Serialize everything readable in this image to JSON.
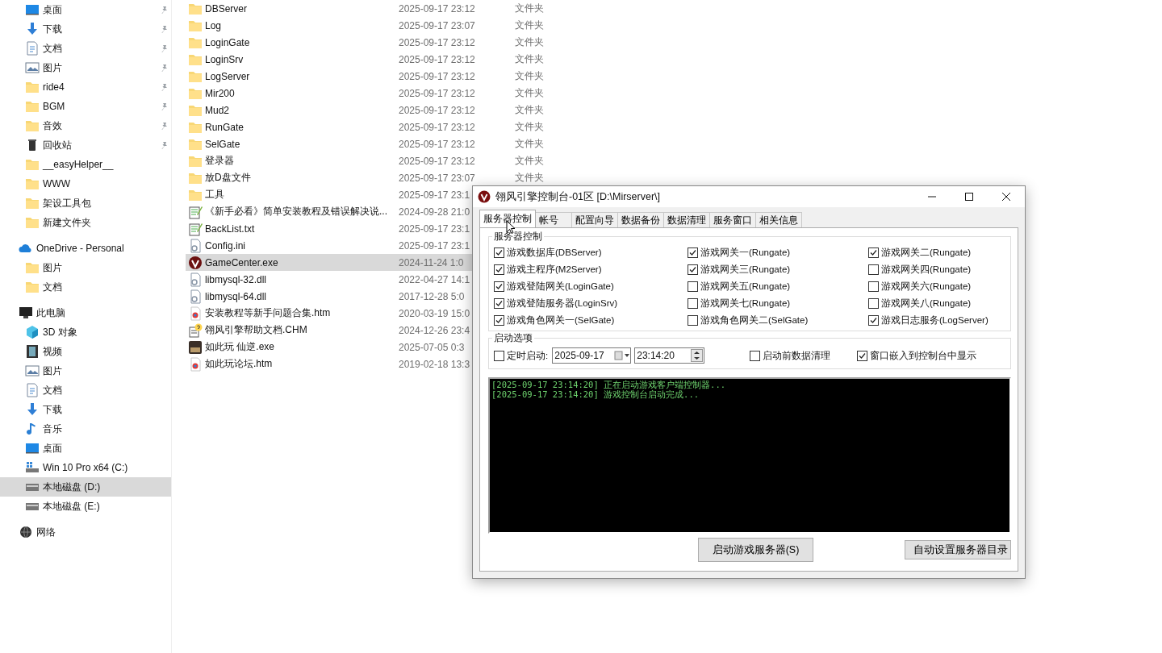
{
  "sidebar": {
    "groups": [
      {
        "items": [
          {
            "label": "桌面",
            "kind": "desktop",
            "pinned": true,
            "selected": false
          },
          {
            "label": "下载",
            "kind": "download",
            "pinned": true,
            "selected": false
          },
          {
            "label": "文档",
            "kind": "document",
            "pinned": true,
            "selected": false
          },
          {
            "label": "图片",
            "kind": "pictures",
            "pinned": true,
            "selected": false
          },
          {
            "label": "ride4",
            "kind": "folder",
            "pinned": true,
            "selected": false
          },
          {
            "label": "BGM",
            "kind": "folder",
            "pinned": true,
            "selected": false
          },
          {
            "label": "音效",
            "kind": "folder",
            "pinned": true,
            "selected": false
          },
          {
            "label": "回收站",
            "kind": "recycle",
            "pinned": true,
            "selected": false
          },
          {
            "label": "__easyHelper__",
            "kind": "folder",
            "pinned": false,
            "selected": false
          },
          {
            "label": "WWW",
            "kind": "folder",
            "pinned": false,
            "selected": false
          },
          {
            "label": "架设工具包",
            "kind": "folder",
            "pinned": false,
            "selected": false
          },
          {
            "label": "新建文件夹",
            "kind": "folder",
            "pinned": false,
            "selected": false
          }
        ]
      },
      {
        "header": {
          "label": "OneDrive - Personal",
          "kind": "cloud",
          "selected": false
        },
        "items": [
          {
            "label": "图片",
            "kind": "folder",
            "pinned": false,
            "selected": false
          },
          {
            "label": "文档",
            "kind": "folder",
            "pinned": false,
            "selected": false
          }
        ]
      },
      {
        "header": {
          "label": "此电脑",
          "kind": "pc",
          "selected": false
        },
        "items": [
          {
            "label": "3D 对象",
            "kind": "cube",
            "pinned": false,
            "selected": false
          },
          {
            "label": "视频",
            "kind": "video",
            "pinned": false,
            "selected": false
          },
          {
            "label": "图片",
            "kind": "pictures",
            "pinned": false,
            "selected": false
          },
          {
            "label": "文档",
            "kind": "document",
            "pinned": false,
            "selected": false
          },
          {
            "label": "下载",
            "kind": "download",
            "pinned": false,
            "selected": false
          },
          {
            "label": "音乐",
            "kind": "music",
            "pinned": false,
            "selected": false
          },
          {
            "label": "桌面",
            "kind": "desktop",
            "pinned": false,
            "selected": false
          },
          {
            "label": "Win 10 Pro x64 (C:)",
            "kind": "sysdrive",
            "pinned": false,
            "selected": false
          },
          {
            "label": "本地磁盘 (D:)",
            "kind": "drive",
            "pinned": false,
            "selected": true
          },
          {
            "label": "本地磁盘 (E:)",
            "kind": "drive",
            "pinned": false,
            "selected": false
          }
        ]
      },
      {
        "header": {
          "label": "网络",
          "kind": "network",
          "selected": false
        }
      }
    ]
  },
  "files": [
    {
      "name": "DBServer",
      "kind": "folder",
      "date": "2025-09-17 23:12",
      "type": "文件夹",
      "selected": false
    },
    {
      "name": "Log",
      "kind": "folder",
      "date": "2025-09-17 23:07",
      "type": "文件夹",
      "selected": false
    },
    {
      "name": "LoginGate",
      "kind": "folder",
      "date": "2025-09-17 23:12",
      "type": "文件夹",
      "selected": false
    },
    {
      "name": "LoginSrv",
      "kind": "folder",
      "date": "2025-09-17 23:12",
      "type": "文件夹",
      "selected": false
    },
    {
      "name": "LogServer",
      "kind": "folder",
      "date": "2025-09-17 23:12",
      "type": "文件夹",
      "selected": false
    },
    {
      "name": "Mir200",
      "kind": "folder",
      "date": "2025-09-17 23:12",
      "type": "文件夹",
      "selected": false
    },
    {
      "name": "Mud2",
      "kind": "folder",
      "date": "2025-09-17 23:12",
      "type": "文件夹",
      "selected": false
    },
    {
      "name": "RunGate",
      "kind": "folder",
      "date": "2025-09-17 23:12",
      "type": "文件夹",
      "selected": false
    },
    {
      "name": "SelGate",
      "kind": "folder",
      "date": "2025-09-17 23:12",
      "type": "文件夹",
      "selected": false
    },
    {
      "name": "登录器",
      "kind": "folder",
      "date": "2025-09-17 23:12",
      "type": "文件夹",
      "selected": false
    },
    {
      "name": "放D盘文件",
      "kind": "folder",
      "date": "2025-09-17 23:07",
      "type": "文件夹",
      "selected": false
    },
    {
      "name": "工具",
      "kind": "folder",
      "date": "2025-09-17 23:1",
      "selected": false
    },
    {
      "name": "《新手必看》简单安装教程及错误解决说...",
      "kind": "text",
      "date": "2024-09-28 21:0",
      "selected": false
    },
    {
      "name": "BackList.txt",
      "kind": "text",
      "date": "2025-09-17 23:1",
      "selected": false
    },
    {
      "name": "Config.ini",
      "kind": "config",
      "date": "2025-09-17 23:1",
      "selected": false
    },
    {
      "name": "GameCenter.exe",
      "kind": "app",
      "date": "2024-11-24 1:0",
      "selected": true
    },
    {
      "name": "libmysql-32.dll",
      "kind": "config",
      "date": "2022-04-27 14:1",
      "selected": false
    },
    {
      "name": "libmysql-64.dll",
      "kind": "config",
      "date": "2017-12-28 5:0",
      "selected": false
    },
    {
      "name": "安装教程等新手问题合集.htm",
      "kind": "web",
      "date": "2020-03-19 15:0",
      "selected": false
    },
    {
      "name": "翎风引擎帮助文档.CHM",
      "kind": "help",
      "date": "2024-12-26 23:4",
      "selected": false
    },
    {
      "name": "如此玩 仙逆.exe",
      "kind": "game",
      "date": "2025-07-05 0:3",
      "selected": false
    },
    {
      "name": "如此玩论坛.htm",
      "kind": "web",
      "date": "2019-02-18 13:3",
      "selected": false
    }
  ],
  "window": {
    "title": "翎风引擎控制台-01区 [D:\\Mirserver\\]",
    "tabs": [
      {
        "label": "服务器控制",
        "selected": true
      },
      {
        "label": "帐号",
        "selected": false
      },
      {
        "label": "配置向导",
        "selected": false
      },
      {
        "label": "数据备份",
        "selected": false
      },
      {
        "label": "数据清理",
        "selected": false
      },
      {
        "label": "服务窗口",
        "selected": false
      },
      {
        "label": "相关信息",
        "selected": false
      }
    ],
    "server_group": {
      "title": "服务器控制",
      "checkboxes": [
        {
          "label": "游戏数据库(DBServer)",
          "checked": true
        },
        {
          "label": "游戏网关一(Rungate)",
          "checked": true
        },
        {
          "label": "游戏网关二(Rungate)",
          "checked": true
        },
        {
          "label": "游戏主程序(M2Server)",
          "checked": true
        },
        {
          "label": "游戏网关三(Rungate)",
          "checked": true
        },
        {
          "label": "游戏网关四(Rungate)",
          "checked": false
        },
        {
          "label": "游戏登陆网关(LoginGate)",
          "checked": true
        },
        {
          "label": "游戏网关五(Rungate)",
          "checked": false
        },
        {
          "label": "游戏网关六(Rungate)",
          "checked": false
        },
        {
          "label": "游戏登陆服务器(LoginSrv)",
          "checked": true
        },
        {
          "label": "游戏网关七(Rungate)",
          "checked": false
        },
        {
          "label": "游戏网关八(Rungate)",
          "checked": false
        },
        {
          "label": "游戏角色网关一(SelGate)",
          "checked": true
        },
        {
          "label": "游戏角色网关二(SelGate)",
          "checked": false
        },
        {
          "label": "游戏日志服务(LogServer)",
          "checked": true
        }
      ]
    },
    "options": {
      "title": "启动选项",
      "scheduled": {
        "label": "定时启动:",
        "checked": false
      },
      "date": "2025-09-17",
      "time": "23:14:20",
      "cleanup": {
        "label": "启动前数据清理",
        "checked": false
      },
      "embed": {
        "label": "窗口嵌入到控制台中显示",
        "checked": true
      }
    },
    "log": [
      "[2025-09-17 23:14:20] 正在启动游戏客户端控制器...",
      "[2025-09-17 23:14:20] 游戏控制台启动完成..."
    ],
    "buttons": {
      "start": "启动游戏服务器(S)",
      "auto_dir": "自动设置服务器目录"
    }
  }
}
